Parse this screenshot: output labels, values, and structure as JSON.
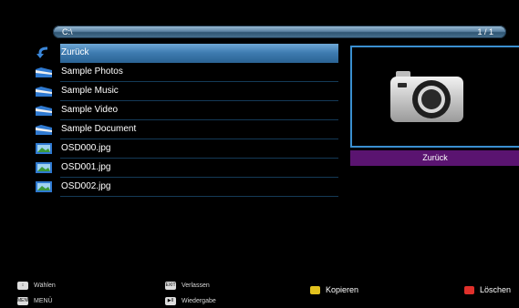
{
  "path_bar": {
    "path": "C:\\",
    "page_indicator": "1 / 1"
  },
  "file_list": {
    "items": [
      {
        "label": "Zurück",
        "icon": "back-arrow-icon",
        "selected": true
      },
      {
        "label": "Sample Photos",
        "icon": "folder-icon"
      },
      {
        "label": "Sample Music",
        "icon": "folder-icon"
      },
      {
        "label": "Sample Video",
        "icon": "folder-icon"
      },
      {
        "label": "Sample Document",
        "icon": "folder-icon"
      },
      {
        "label": "OSD000.jpg",
        "icon": "image-file-icon"
      },
      {
        "label": "OSD001.jpg",
        "icon": "image-file-icon"
      },
      {
        "label": "OSD002.jpg",
        "icon": "image-file-icon"
      }
    ]
  },
  "preview": {
    "icon": "camera-icon",
    "caption": "Zurück"
  },
  "footer": {
    "select": {
      "key": "↕",
      "label": "Wählen"
    },
    "menu": {
      "key": "MENU",
      "label": "MENÜ"
    },
    "exit": {
      "key": "EXIT",
      "label": "Verlassen"
    },
    "play": {
      "key": "▶II",
      "label": "Wiedergabe"
    },
    "copy": {
      "label": "Kopieren"
    },
    "delete": {
      "label": "Löschen"
    }
  },
  "colors": {
    "selection": "#3e7bb0",
    "caption_bg": "#5a1470",
    "preview_border": "#3a8fd0"
  }
}
